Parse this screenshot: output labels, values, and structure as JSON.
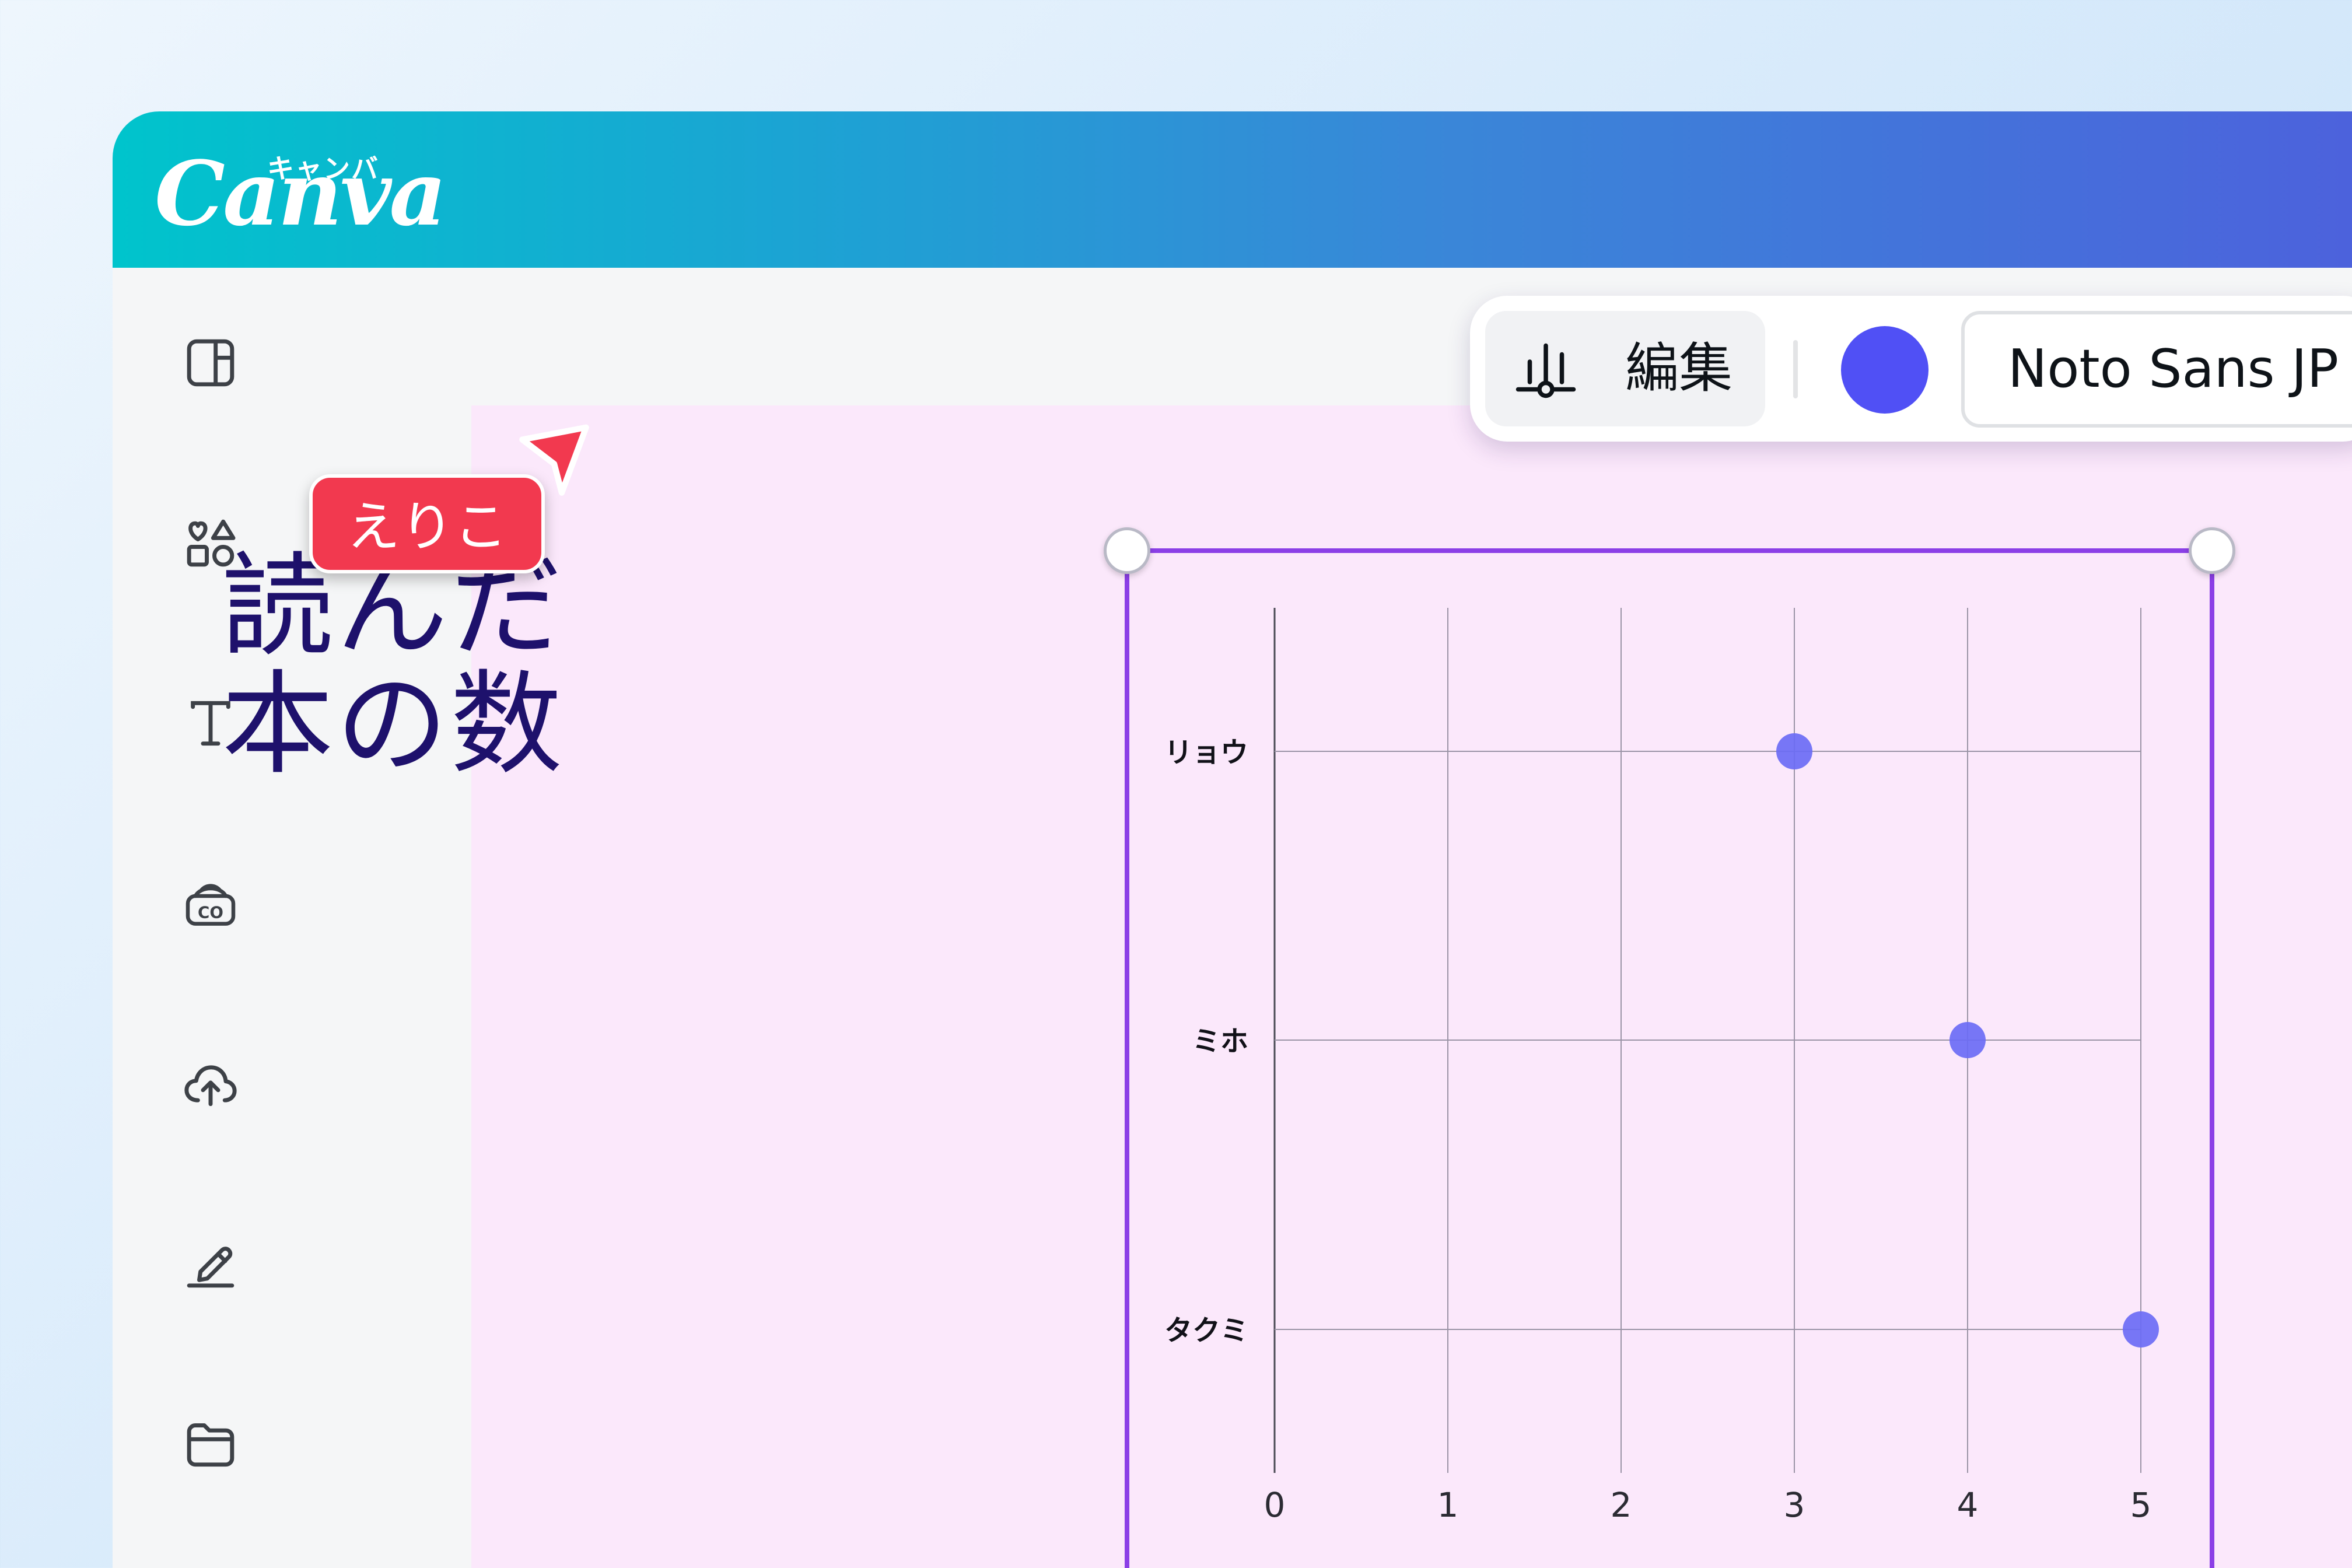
{
  "app": {
    "logo_text": "Canva",
    "logo_kana": "キャンバ"
  },
  "sidebar": {
    "items": [
      {
        "icon": "layout-icon"
      },
      {
        "icon": "elements-icon"
      },
      {
        "icon": "text-icon"
      },
      {
        "icon": "brand-icon"
      },
      {
        "icon": "cloud-upload-icon"
      },
      {
        "icon": "draw-icon"
      },
      {
        "icon": "folder-icon"
      }
    ]
  },
  "toolbar": {
    "edit_label": "編集",
    "color_value": "#5050f5",
    "font_name": "Noto Sans JP"
  },
  "canvas": {
    "title_line1": "読んだ",
    "title_line2": "本の数",
    "title_color": "#1e116c",
    "background": "#fbe8fb"
  },
  "collaborator": {
    "name": "えりこ",
    "color": "#f2394f"
  },
  "chart_data": {
    "type": "scatter",
    "categories": [
      "リョウ",
      "ミホ",
      "タクミ"
    ],
    "values": [
      3,
      4,
      5
    ],
    "xlim": [
      0,
      5
    ],
    "xticks": [
      "0",
      "1",
      "2",
      "3",
      "4",
      "5"
    ],
    "grid": true,
    "point_color": "#6b6bf5"
  }
}
